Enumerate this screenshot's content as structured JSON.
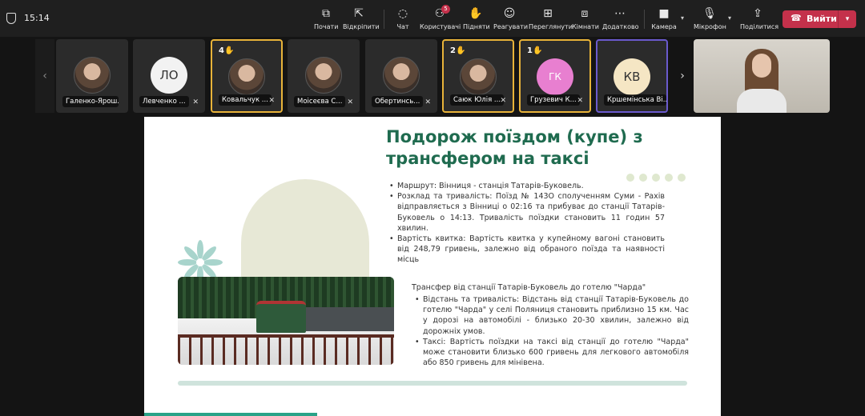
{
  "topbar": {
    "time": "15:14",
    "tools": [
      {
        "icon": "start-icon",
        "label": "Почати"
      },
      {
        "icon": "unpin-icon",
        "label": "Відкріпити"
      },
      {
        "icon": "chat-icon",
        "label": "Чат"
      },
      {
        "icon": "people-icon",
        "label": "Користувачі",
        "badge": "5"
      },
      {
        "icon": "hand-icon",
        "label": "Підняти"
      },
      {
        "icon": "react-icon",
        "label": "Реагувати"
      },
      {
        "icon": "view-icon",
        "label": "Переглянути"
      },
      {
        "icon": "rooms-icon",
        "label": "Кімнати"
      },
      {
        "icon": "more-icon",
        "label": "Додатково"
      },
      {
        "icon": "camera-icon",
        "label": "Камера"
      },
      {
        "icon": "mic-icon",
        "label": "Мікрофон"
      },
      {
        "icon": "share-icon",
        "label": "Поділитися"
      }
    ],
    "leave_label": "Вийти",
    "leave_color": "#c4314b"
  },
  "participants": [
    {
      "name": "Галенко-Ярош...",
      "type": "photo"
    },
    {
      "name": "Левченко ...",
      "initials": "ЛО",
      "color": "#f2f2f2",
      "muted": true
    },
    {
      "name": "Ковальчук ...",
      "type": "photo",
      "hand": "4",
      "muted": true
    },
    {
      "name": "Моісеєва С...",
      "type": "photo",
      "muted": true
    },
    {
      "name": "Обертинсь...",
      "type": "photo",
      "muted": true
    },
    {
      "name": "Саюк Юлія ...",
      "type": "photo",
      "hand": "2",
      "muted": true
    },
    {
      "name": "Грузевич К...",
      "initials": "ГК",
      "color": "#e87fd0",
      "hand": "1",
      "muted": true
    },
    {
      "name": "Кршемінська Ві...",
      "initials": "КВ",
      "color": "#f5e6c4"
    }
  ],
  "slide": {
    "title": "Подорож поїздом (купе) з трансфером на таксі",
    "items1": [
      "Маршрут: Вінниця - станція Татарів-Буковель.",
      "Розклад та тривалість: Поїзд № 143О сполученням Суми - Рахів відправляється з Вінниці о 02:16 та прибуває до станції Татарів-Буковель о 14:13. Тривалість поїздки становить 11 годин 57 хвилин.",
      "Вартість квитка: Вартість квитка у купейному вагоні становить від 248,79 гривень, залежно від обраного поїзда та наявності місць"
    ],
    "subtitle2": "Трансфер від станції Татарів-Буковель до готелю \"Чарда\"",
    "items2": [
      "Відстань та тривалість: Відстань від станції Татарів-Буковель до готелю \"Чарда\" у селі Поляниця становить приблизно 15 км. Час у дорозі на автомобілі - близько 20-30 хвилин, залежно від дорожніх умов.",
      "Таксі: Вартість поїздки на таксі від станції до готелю \"Чарда\" може становити близько 600 гривень для легкового автомобіля або 850 гривень для мінівена."
    ],
    "title_color": "#1f6b4f",
    "progress": 0.3
  }
}
